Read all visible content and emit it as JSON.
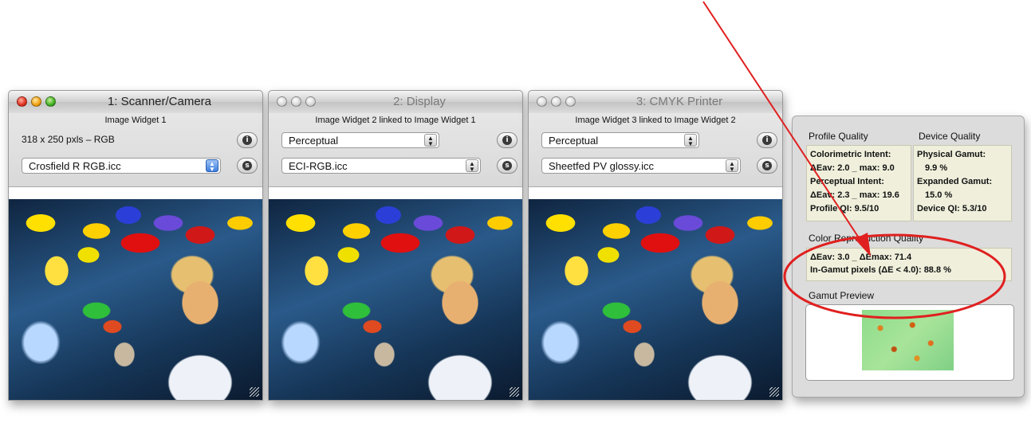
{
  "windows": [
    {
      "title": "1: Scanner/Camera",
      "widget_label": "Image Widget 1",
      "info": "318 x 250 pxls – RGB",
      "profile": "Crosfield R RGB.icc"
    },
    {
      "title": "2: Display",
      "widget_label": "Image Widget 2 linked to Image Widget 1",
      "intent": "Perceptual",
      "profile": "ECI-RGB.icc"
    },
    {
      "title": "3: CMYK Printer",
      "widget_label": "Image Widget 3 linked to Image Widget 2",
      "intent": "Perceptual",
      "profile": "Sheetfed PV glossy.icc"
    }
  ],
  "quality": {
    "profile_quality_label": "Profile Quality",
    "device_quality_label": "Device Quality",
    "profile_lines": [
      "Colorimetric Intent:",
      "ΔEav: 2.0 _ max: 9.0",
      "Perceptual Intent:",
      "ΔEav: 2.3 _ max: 19.6",
      "Profile QI: 9.5/10"
    ],
    "device_lines": [
      "Physical Gamut:",
      "9.9 %",
      "Expanded Gamut:",
      "15.0 %",
      "Device QI: 5.3/10"
    ],
    "color_repro_label": "Color Reproduction Quality",
    "color_repro_lines": [
      "ΔEav: 3.0 _ ΔEmax: 71.4",
      "In-Gamut pixels (ΔE < 4.0): 88.8 %"
    ],
    "gamut_preview_label": "Gamut Preview"
  },
  "icons": {
    "info": "info-icon",
    "settings": "s-icon"
  },
  "colors": {
    "annotation": "#e02020"
  }
}
